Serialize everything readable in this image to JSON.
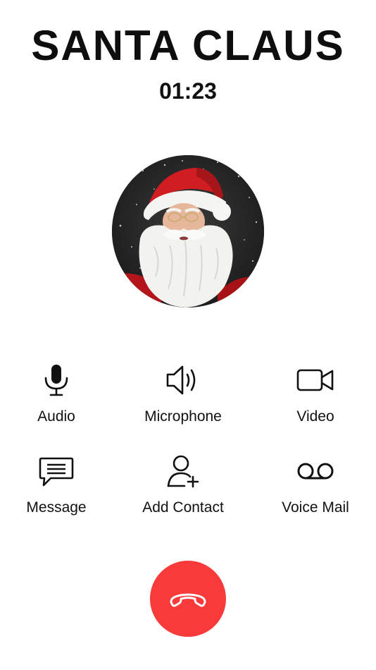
{
  "caller": {
    "name": "SANTA CLAUS",
    "duration": "01:23"
  },
  "avatar": {
    "icon": "santa-claus-photo"
  },
  "actions": [
    {
      "label": "Audio",
      "icon": "microphone-icon"
    },
    {
      "label": "Microphone",
      "icon": "speaker-icon"
    },
    {
      "label": "Video",
      "icon": "video-camera-icon"
    },
    {
      "label": "Message",
      "icon": "message-bubble-icon"
    },
    {
      "label": "Add Contact",
      "icon": "add-person-icon"
    },
    {
      "label": "Voice Mail",
      "icon": "voicemail-icon"
    }
  ],
  "end_call": {
    "icon": "phone-hangup-icon"
  },
  "colors": {
    "background": "#ffffff",
    "text": "#111111",
    "end_call": "#f93a3a"
  }
}
